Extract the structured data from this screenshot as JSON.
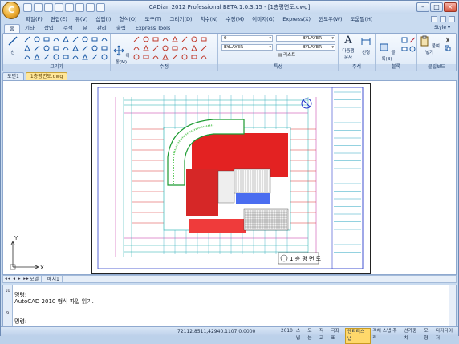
{
  "app": {
    "title": "CADian 2012 Professional BETA 1.0.3.15 - [1층평면도.dwg]",
    "orb_letter": "C"
  },
  "window_controls": {
    "minimize": "–",
    "maximize": "□",
    "close": "×"
  },
  "menu": {
    "items": [
      "파일(F)",
      "편집(E)",
      "뷰(V)",
      "삽입(I)",
      "형식(O)",
      "도구(T)",
      "그리기(D)",
      "치수(N)",
      "수정(M)",
      "이미지(G)",
      "Express(X)",
      "윈도우(W)",
      "도움말(H)"
    ]
  },
  "ribbon_tabs": {
    "items": [
      "홈",
      "기타",
      "삽입",
      "주석",
      "뷰",
      "관리",
      "출력",
      "Express Tools"
    ],
    "active_index": 0,
    "style_label": "Style ▾"
  },
  "ribbon_panels": {
    "draw_label": "그리기",
    "modify_label": "수정",
    "props_label": "특성",
    "annot_label": "주석",
    "block_label": "블록",
    "clip_label": "클립보드",
    "line_tool_label": "선",
    "move_label": "이동(M)",
    "layer_value": "0",
    "bylayer_1": "BYLAYER",
    "bylayer_2": "BYLAYER",
    "bylayer_3": "BYLAYER",
    "list_label": "리스트",
    "text_label": "다중행 문자",
    "dim_label": "선형",
    "block_insert_label": "블록(B)",
    "paste_label": "붙여넣기"
  },
  "doc_tabs": {
    "items": [
      "도면1",
      "1층평면도.dwg"
    ],
    "active_index": 1
  },
  "drawing": {
    "title_block_text": "1 층 평 면 도",
    "ucs_y": "Y",
    "ucs_x": "X"
  },
  "model_tabs": {
    "nav": "◂◂ ◂ ▸ ▸▸",
    "items": [
      "모델",
      "배치1"
    ]
  },
  "command": {
    "side_labels": [
      "10",
      "9"
    ],
    "lines": [
      "명령:",
      "AutoCAD 2010 형식 파일 읽기."
    ],
    "prompt": "명령:"
  },
  "status": {
    "coords": "72112.8511,42940.1107,0.0000",
    "buttons": [
      "2010",
      "스냅",
      "모눈",
      "직교",
      "극좌표",
      "엔티티스냅",
      "객체 스냅 추적",
      "선가중치",
      "모형",
      "디지타이저"
    ],
    "active_index": 5
  }
}
